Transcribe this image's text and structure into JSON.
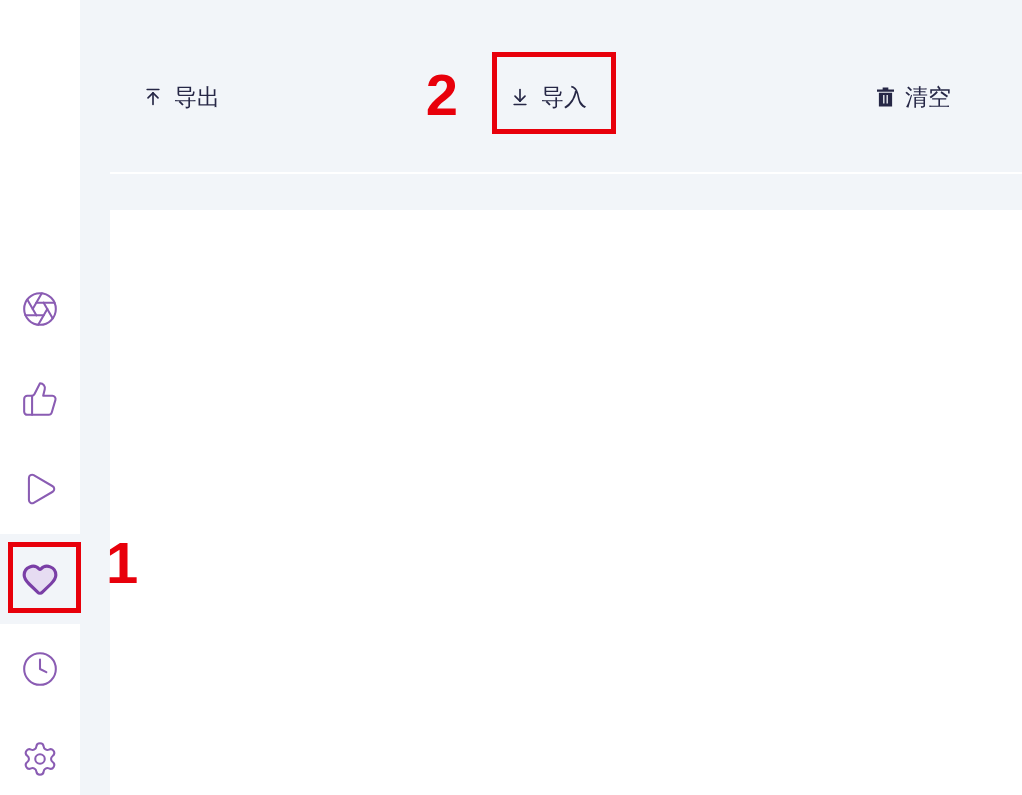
{
  "sidebar": {
    "items": [
      {
        "kind": "aperture",
        "selected": false
      },
      {
        "kind": "like",
        "selected": false
      },
      {
        "kind": "play",
        "selected": false
      },
      {
        "kind": "favorite",
        "selected": true,
        "callout": "1"
      },
      {
        "kind": "history",
        "selected": false
      },
      {
        "kind": "settings",
        "selected": false
      }
    ]
  },
  "toolbar": {
    "buttons": [
      {
        "kind": "export",
        "label": "导出"
      },
      {
        "kind": "import",
        "label": "导入",
        "callout": "2"
      },
      {
        "kind": "clear",
        "label": "清空"
      }
    ]
  }
}
